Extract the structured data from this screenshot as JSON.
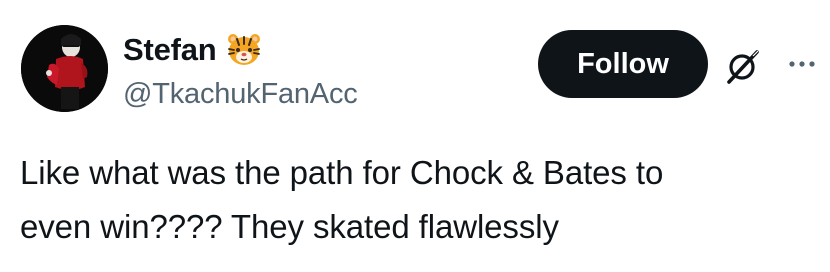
{
  "author": {
    "display_name": "Stefan",
    "handle": "@TkachukFanAcc",
    "name_emoji_icon": "tiger-face-icon",
    "avatar": "profile-photo"
  },
  "actions": {
    "follow_label": "Follow",
    "grok_icon": "grok-icon",
    "more_icon": "more-dots-icon"
  },
  "tweet": {
    "line1": "Like what was the path for Chock & Bates to",
    "line2": "even win???? They skated flawlessly"
  },
  "colors": {
    "text_primary": "#0f1419",
    "text_secondary": "#536471",
    "button_bg": "#0f1419",
    "button_text": "#ffffff",
    "background": "#ffffff"
  }
}
